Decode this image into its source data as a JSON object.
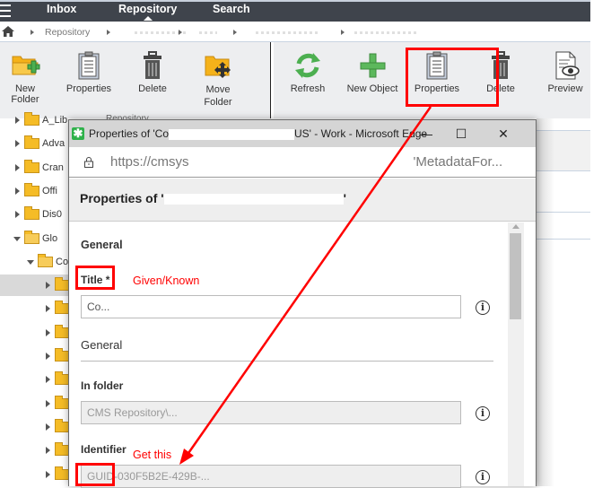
{
  "topnav": {
    "tabs": [
      {
        "label": "Inbox",
        "active": false
      },
      {
        "label": "Repository",
        "active": true
      },
      {
        "label": "Search",
        "active": false
      }
    ]
  },
  "breadcrumb": {
    "items": [
      "Repository",
      "",
      "",
      "",
      ""
    ]
  },
  "ribbon_left": {
    "buttons": [
      {
        "label": "New Folder",
        "icon": "new-folder-icon"
      },
      {
        "label": "Properties",
        "icon": "clipboard-icon"
      },
      {
        "label": "Delete",
        "icon": "trash-icon"
      },
      {
        "label": "Move Folder",
        "icon": "move-folder-icon"
      }
    ],
    "group_label": "Repository"
  },
  "ribbon_right": {
    "buttons": [
      {
        "label": "Refresh",
        "icon": "refresh-icon"
      },
      {
        "label": "New Object",
        "icon": "plus-icon"
      },
      {
        "label": "Properties",
        "icon": "clipboard-icon"
      },
      {
        "label": "Delete",
        "icon": "trash-icon"
      },
      {
        "label": "Preview",
        "icon": "preview-icon"
      }
    ]
  },
  "tree": {
    "rows": [
      {
        "label": "A_Lib",
        "level": 1,
        "expanded": false
      },
      {
        "label": "Adva",
        "level": 1,
        "expanded": false
      },
      {
        "label": "Cran",
        "level": 1,
        "expanded": false
      },
      {
        "label": "Offi",
        "level": 1,
        "expanded": false
      },
      {
        "label": "Dis0",
        "level": 1,
        "expanded": false
      },
      {
        "label": "Glo",
        "level": 1,
        "expanded": true
      },
      {
        "label": "Co",
        "level": 2,
        "expanded": true
      },
      {
        "label": "",
        "level": 3,
        "expanded": false,
        "selected": true
      },
      {
        "label": "",
        "level": 3,
        "expanded": false
      },
      {
        "label": "",
        "level": 3,
        "expanded": false
      },
      {
        "label": "",
        "level": 3,
        "expanded": false
      },
      {
        "label": "",
        "level": 3,
        "expanded": false
      },
      {
        "label": "",
        "level": 3,
        "expanded": false
      },
      {
        "label": "",
        "level": 3,
        "expanded": false
      },
      {
        "label": "",
        "level": 3,
        "expanded": false
      },
      {
        "label": "",
        "level": 3,
        "expanded": false
      }
    ]
  },
  "popup": {
    "window_title": "Properties of 'Co...US' - Work - Microsoft Edge",
    "url": "https://cmsys.../MetadataFor...",
    "heading": "Properties of '...'",
    "controls": {
      "minimize": "—",
      "maximize": "☐",
      "close": "✕"
    },
    "sections": {
      "general_title": "General",
      "title_label": "Title *",
      "title_value": "Co...",
      "general_text": "General",
      "folder_label": "In folder",
      "folder_value": "CMS Repository\\...",
      "identifier_label": "Identifier",
      "identifier_value": "GUID-030F5B2E-429B-..."
    }
  },
  "annotations": {
    "given_known": "Given/Known",
    "get_this": "Get this",
    "color": "#ff0000"
  }
}
